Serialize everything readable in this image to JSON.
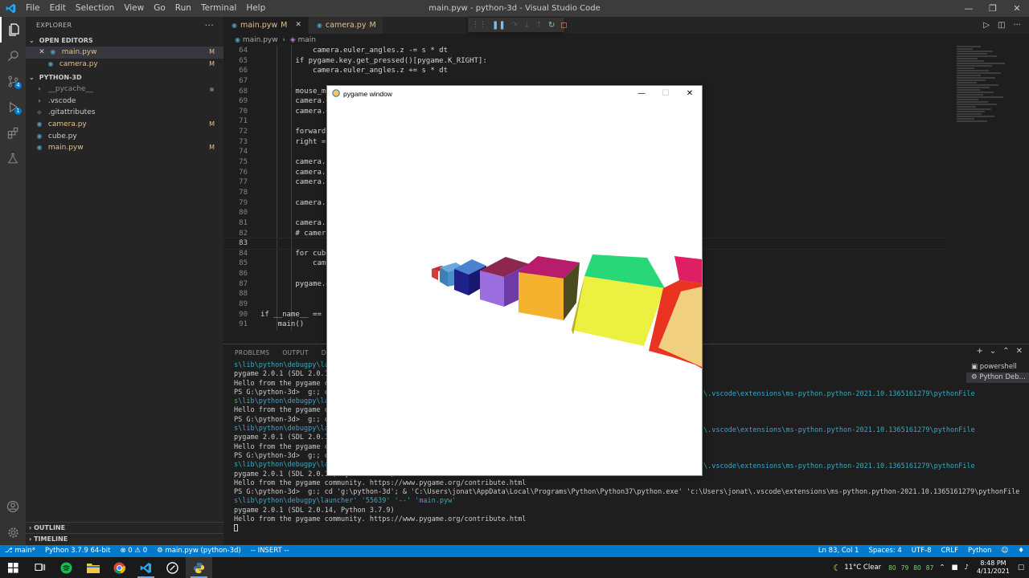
{
  "titlebar": {
    "menu": [
      "File",
      "Edit",
      "Selection",
      "View",
      "Go",
      "Run",
      "Terminal",
      "Help"
    ],
    "title": "main.pyw - python-3d - Visual Studio Code"
  },
  "activity": {
    "source_control_badge": "4",
    "run_badge": "1"
  },
  "sidebar": {
    "header": "EXPLORER",
    "open_editors": {
      "title": "OPEN EDITORS",
      "items": [
        {
          "name": "main.pyw",
          "status": "M"
        },
        {
          "name": "camera.py",
          "status": "M"
        }
      ]
    },
    "project": {
      "title": "PYTHON-3D",
      "items": [
        {
          "name": "__pycache__",
          "status": ""
        },
        {
          "name": ".vscode",
          "status": ""
        },
        {
          "name": ".gitattributes",
          "status": ""
        },
        {
          "name": "camera.py",
          "status": "M"
        },
        {
          "name": "cube.py",
          "status": ""
        },
        {
          "name": "main.pyw",
          "status": "M"
        }
      ]
    },
    "outline": "OUTLINE",
    "timeline": "TIMELINE"
  },
  "tabs": [
    {
      "name": "main.pyw",
      "status": "M"
    },
    {
      "name": "camera.py",
      "status": "M"
    }
  ],
  "breadcrumb": {
    "file": "main.pyw",
    "symbol": "main"
  },
  "code": [
    {
      "ln": "64",
      "text": "            camera.euler_angles.z -= s * dt"
    },
    {
      "ln": "65",
      "text": "        if pygame.key.get_pressed()[pygame.K_RIGHT]:"
    },
    {
      "ln": "66",
      "text": "            camera.euler_angles.z += s * dt"
    },
    {
      "ln": "67",
      "text": ""
    },
    {
      "ln": "68",
      "text": "        mouse_mo"
    },
    {
      "ln": "69",
      "text": "        camera.e"
    },
    {
      "ln": "70",
      "text": "        camera.e"
    },
    {
      "ln": "71",
      "text": ""
    },
    {
      "ln": "72",
      "text": "        forward"
    },
    {
      "ln": "73",
      "text": "        right = "
    },
    {
      "ln": "74",
      "text": ""
    },
    {
      "ln": "75",
      "text": "        camera.p"
    },
    {
      "ln": "76",
      "text": "        camera.p"
    },
    {
      "ln": "77",
      "text": "        camera.p"
    },
    {
      "ln": "78",
      "text": ""
    },
    {
      "ln": "79",
      "text": "        camera.s"
    },
    {
      "ln": "80",
      "text": ""
    },
    {
      "ln": "81",
      "text": "        camera.r"
    },
    {
      "ln": "82",
      "text": "        # camera"
    },
    {
      "ln": "83",
      "text": ""
    },
    {
      "ln": "84",
      "text": "        for cube"
    },
    {
      "ln": "85",
      "text": "            came"
    },
    {
      "ln": "86",
      "text": ""
    },
    {
      "ln": "87",
      "text": "        pygame.d"
    },
    {
      "ln": "88",
      "text": ""
    },
    {
      "ln": "89",
      "text": ""
    },
    {
      "ln": "90",
      "text": "if __name__ == '"
    },
    {
      "ln": "91",
      "text": "    main()"
    }
  ],
  "panel": {
    "tabs": [
      "PROBLEMS",
      "OUTPUT",
      "DEBU"
    ],
    "terminals": [
      "powershell",
      "Python Deb..."
    ],
    "lines": [
      {
        "t": "s\\lib\\python\\debugpy\\laun",
        "c": "cyan"
      },
      {
        "t": "pygame 2.0.1 (SDL 2.0.14,",
        "c": "p"
      },
      {
        "t": "Hello from the pygame com",
        "c": "p"
      },
      {
        "t": "PS G:\\python-3d>  g:; cd ",
        "c": "ps"
      },
      {
        "t": "s\\lib\\python\\debugpy\\laun",
        "c": "cyan"
      },
      {
        "t": "Hello from the pygame com",
        "c": "p"
      },
      {
        "t": "PS G:\\python-3d>  g:; cd ",
        "c": "ps"
      },
      {
        "t": "s\\lib\\python\\debugpy\\laun",
        "c": "cyan"
      },
      {
        "t": "pygame 2.0.1 (SDL 2.0.14,",
        "c": "p"
      },
      {
        "t": "Hello from the pygame com",
        "c": "p"
      },
      {
        "t": "PS G:\\python-3d>  g:; cd ",
        "c": "ps"
      },
      {
        "t": "s\\lib\\python\\debugpy\\launcher' '55637' '--' 'main.pyw'",
        "c": "cyan"
      },
      {
        "t": "pygame 2.0.1 (SDL 2.0.14, Python 3.7.9)",
        "c": "p"
      },
      {
        "t": "Hello from the pygame community. https://www.pygame.org/contribute.html",
        "c": "p"
      },
      {
        "t": "PS G:\\python-3d>  g:; cd 'g:\\python-3d'; & 'C:\\Users\\jonat\\AppData\\Local\\Programs\\Python\\Python37\\python.exe' 'c:\\Users\\jonat\\.vscode\\extensions\\ms-python.python-2021.10.1365161279\\pythonFile",
        "c": "ps"
      },
      {
        "t": "s\\lib\\python\\debugpy\\launcher' '55639' '--' 'main.pyw'",
        "c": "cyan"
      },
      {
        "t": "pygame 2.0.1 (SDL 2.0.14, Python 3.7.9)",
        "c": "p"
      },
      {
        "t": "Hello from the pygame community. https://www.pygame.org/contribute.html",
        "c": "p"
      },
      {
        "t": "",
        "c": "cursor"
      }
    ],
    "right_fragment": "\\.vscode\\extensions\\ms-python.python-2021.10.1365161279\\pythonFile"
  },
  "pygame": {
    "title": "pygame window",
    "cube_colors": [
      "#e8e840",
      "#f5b22e",
      "#9b6ee0",
      "#2020a0",
      "#4a90c8",
      "#d63a3a",
      "#28d878",
      "#e01e64",
      "#f0d080"
    ]
  },
  "statusbar": {
    "branch": "main*",
    "python": "Python 3.7.9 64-bit",
    "problems": "⊗ 0 ⚠ 0",
    "debug": "main.pyw (python-3d)",
    "mode": "-- INSERT --",
    "position": "Ln 83, Col 1",
    "spaces": "Spaces: 4",
    "encoding": "UTF-8",
    "eol": "CRLF",
    "language": "Python"
  },
  "taskbar": {
    "weather": "11°C  Clear",
    "tray_nums": [
      "80",
      "79",
      "80",
      "87"
    ],
    "time": "8:48 PM",
    "date": "4/11/2021"
  }
}
